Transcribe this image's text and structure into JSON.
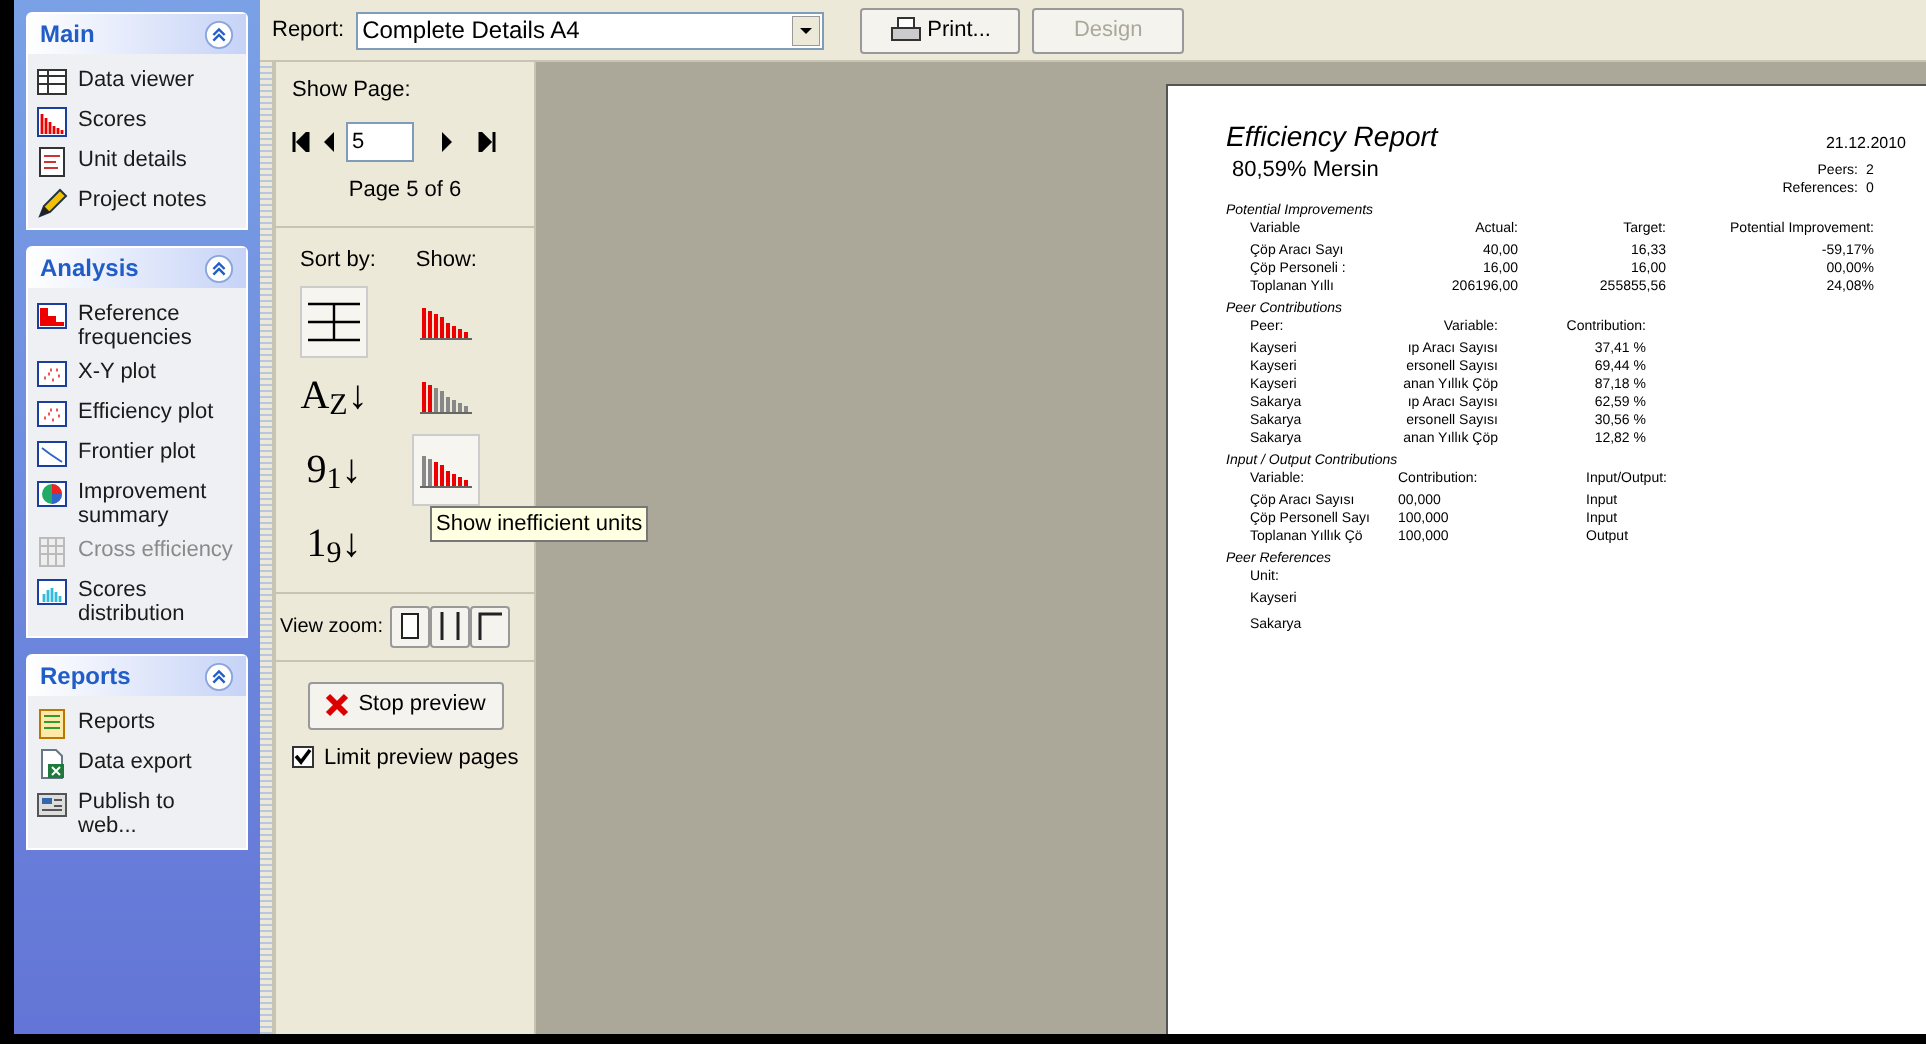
{
  "sidebar": {
    "groups": [
      {
        "title": "Main",
        "items": [
          {
            "label": "Data viewer",
            "kind": "grid",
            "disabled": false
          },
          {
            "label": "Scores",
            "kind": "bars",
            "disabled": false
          },
          {
            "label": "Unit details",
            "kind": "doc",
            "disabled": false
          },
          {
            "label": "Project notes",
            "kind": "pen",
            "disabled": false
          }
        ]
      },
      {
        "title": "Analysis",
        "items": [
          {
            "label": "Reference frequencies",
            "kind": "redchart",
            "disabled": false
          },
          {
            "label": "X-Y plot",
            "kind": "scatter",
            "disabled": false
          },
          {
            "label": "Efficiency plot",
            "kind": "scatter",
            "disabled": false
          },
          {
            "label": "Frontier plot",
            "kind": "frontier",
            "disabled": false
          },
          {
            "label": "Improvement summary",
            "kind": "pie",
            "disabled": false
          },
          {
            "label": "Cross efficiency",
            "kind": "columns",
            "disabled": true
          },
          {
            "label": "Scores distribution",
            "kind": "histogram",
            "disabled": false
          }
        ]
      },
      {
        "title": "Reports",
        "items": [
          {
            "label": "Reports",
            "kind": "report",
            "disabled": false
          },
          {
            "label": "Data export",
            "kind": "excel",
            "disabled": false
          },
          {
            "label": "Publish to web...",
            "kind": "web",
            "disabled": false
          }
        ]
      }
    ]
  },
  "toolbar": {
    "report_label": "Report:",
    "report_value": "Complete Details A4",
    "print": "Print...",
    "design": {
      "label": "Design",
      "disabled": true
    }
  },
  "controls": {
    "show_page_label": "Show Page:",
    "page_value": "5",
    "page_info": "Page 5 of 6",
    "sort_by_label": "Sort by:",
    "show_label": "Show:",
    "sort_options": [
      {
        "kind": "grid",
        "selected": true
      },
      {
        "kind": "text",
        "glyph": "A$_{Z}$↓",
        "selected": false
      },
      {
        "kind": "text",
        "glyph": "9$_{1}$↓",
        "selected": false
      },
      {
        "kind": "text",
        "glyph": "1$_{9}$↓",
        "selected": false
      }
    ],
    "show_options": [
      {
        "kind": "all",
        "selected": false
      },
      {
        "kind": "efficient",
        "selected": false
      },
      {
        "kind": "inefficient",
        "selected": true
      }
    ],
    "tooltip": "Show inefficient units",
    "view_zoom_label": "View zoom:",
    "zoom_options": [
      {
        "kind": "page"
      },
      {
        "kind": "width"
      },
      {
        "kind": "corner"
      }
    ],
    "stop_preview": "Stop preview",
    "limit_preview": {
      "label": "Limit preview pages",
      "checked": true
    }
  },
  "report": {
    "title": "Efficiency Report",
    "date": "21.12.2010",
    "score": "80,59% Mersin",
    "peers_label": "Peers:",
    "peers_value": "2",
    "references_label": "References:",
    "references_value": "0",
    "sections": [
      {
        "title": "Potential Improvements",
        "columns": [
          "Variable",
          "Actual:",
          "Target:",
          "Potential Improvement:"
        ],
        "rows": [
          [
            "Çöp Aracı Sayı",
            "40,00",
            "16,33",
            "-59,17%"
          ],
          [
            "Çöp Personeli :",
            "16,00",
            "16,00",
            "00,00%"
          ],
          [
            "Toplanan Yıllı",
            "206196,00",
            "255855,56",
            "24,08%"
          ]
        ]
      },
      {
        "title": "Peer Contributions",
        "columns": [
          "Peer:",
          "Variable:",
          "Contribution:"
        ],
        "rows": [
          [
            "Kayseri",
            "ıp Aracı Sayısı",
            "37,41 %"
          ],
          [
            "Kayseri",
            "ersonell Sayısı",
            "69,44 %"
          ],
          [
            "Kayseri",
            "anan Yıllık Çöp",
            "87,18 %"
          ],
          [
            "Sakarya",
            "ıp Aracı Sayısı",
            "62,59 %"
          ],
          [
            "Sakarya",
            "ersonell Sayısı",
            "30,56 %"
          ],
          [
            "Sakarya",
            "anan Yıllık Çöp",
            "12,82 %"
          ]
        ]
      },
      {
        "title": "Input / Output Contributions",
        "columns": [
          "Variable:",
          "Contribution:",
          "Input/Output:"
        ],
        "rows": [
          [
            "Çöp Aracı Sayısı",
            "00,000",
            "Input"
          ],
          [
            "Çöp Personell Sayı",
            "100,000",
            "Input"
          ],
          [
            "Toplanan Yıllık Çö",
            "100,000",
            "Output"
          ]
        ]
      },
      {
        "title": "Peer References",
        "columns": [
          "Unit:"
        ],
        "rows": [
          [
            "Kayseri"
          ],
          [
            "Sakarya"
          ]
        ]
      }
    ]
  }
}
